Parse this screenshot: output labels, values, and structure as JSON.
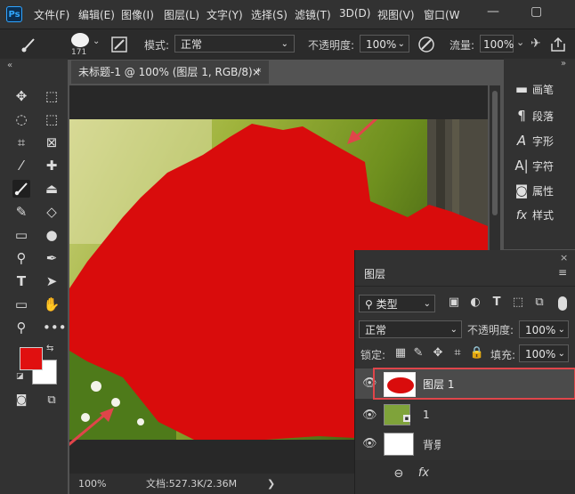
{
  "app": {
    "logo": "Ps"
  },
  "menu": [
    "文件(F)",
    "编辑(E)",
    "图像(I)",
    "图层(L)",
    "文字(Y)",
    "选择(S)",
    "滤镜(T)",
    "3D(D)",
    "视图(V)",
    "窗口(W"
  ],
  "window_controls": [
    "—",
    "▢"
  ],
  "options": {
    "brush_size": "171",
    "mode_label": "模式:",
    "mode_value": "正常",
    "opacity_label": "不透明度:",
    "opacity_value": "100%",
    "flow_label": "流量:",
    "flow_value": "100%"
  },
  "document": {
    "tab_title": "未标题-1 @ 100% (图层 1, RGB/8) *",
    "close": "×",
    "zoom": "100%",
    "doc_info": "文档:527.3K/2.36M",
    "status_arrow": "❯"
  },
  "side_panel": [
    {
      "icon": "brush-icon",
      "label": "画笔"
    },
    {
      "icon": "paragraph-icon",
      "label": "段落"
    },
    {
      "icon": "character-icon",
      "label": "字形"
    },
    {
      "icon": "glyph-icon",
      "label": "字符"
    },
    {
      "icon": "properties-icon",
      "label": "属性"
    },
    {
      "icon": "fx-icon",
      "label": "样式"
    }
  ],
  "layers_panel": {
    "title": "图层",
    "filter_kind": "类型",
    "blend_mode": "正常",
    "opacity_label": "不透明度:",
    "opacity_value": "100%",
    "lock_label": "锁定:",
    "fill_label": "填充:",
    "fill_value": "100%",
    "layers": [
      {
        "name": "图层 1",
        "selected": true
      },
      {
        "name": "1",
        "selected": false
      },
      {
        "name": "背景",
        "selected": false
      }
    ]
  },
  "colors": {
    "foreground": "#e01010",
    "background": "#ffffff",
    "highlight": "#e0454a",
    "paint": "#d90c0c"
  }
}
